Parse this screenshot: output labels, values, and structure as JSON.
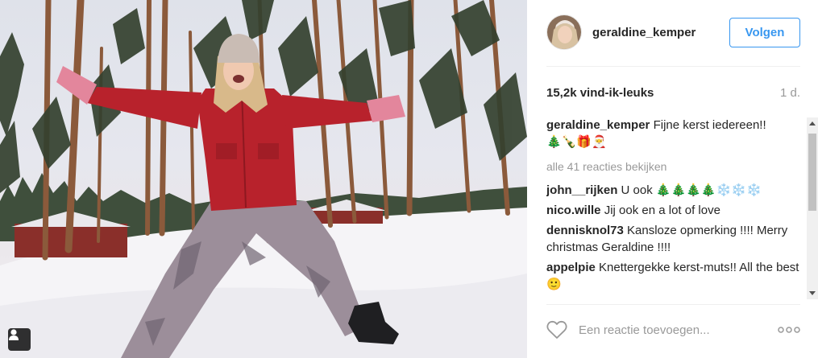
{
  "post": {
    "username": "geraldine_kemper",
    "follow_label": "Volgen",
    "likes": "15,2k vind-ik-leuks",
    "time": "1 d.",
    "caption": {
      "user": "geraldine_kemper",
      "text": "Fijne kerst iedereen!!",
      "emoji": "🎄🍾🎁🎅"
    },
    "view_all_comments": "alle 41 reacties bekijken",
    "comments": [
      {
        "user": "john__rijken",
        "text": "U ook 🎄🎄🎄🎄❄️❄️❄️"
      },
      {
        "user": "nico.wille",
        "text": "Jij ook en a lot of love"
      },
      {
        "user": "dennisknol73",
        "text": "Kansloze opmerking !!!! Merry christmas Geraldine !!!!"
      },
      {
        "user": "appelpie",
        "text": "Knettergekke kerst-muts!! All the best 🙂"
      }
    ],
    "comment_placeholder": "Een reactie toevoegen..."
  },
  "icons": {
    "heart": "heart-outline-icon",
    "more": "more-options-icon",
    "user_tag": "user-tag-icon"
  },
  "colors": {
    "accent": "#3897f0",
    "text": "#262626",
    "muted": "#999999",
    "jacket": "#b8222c"
  }
}
